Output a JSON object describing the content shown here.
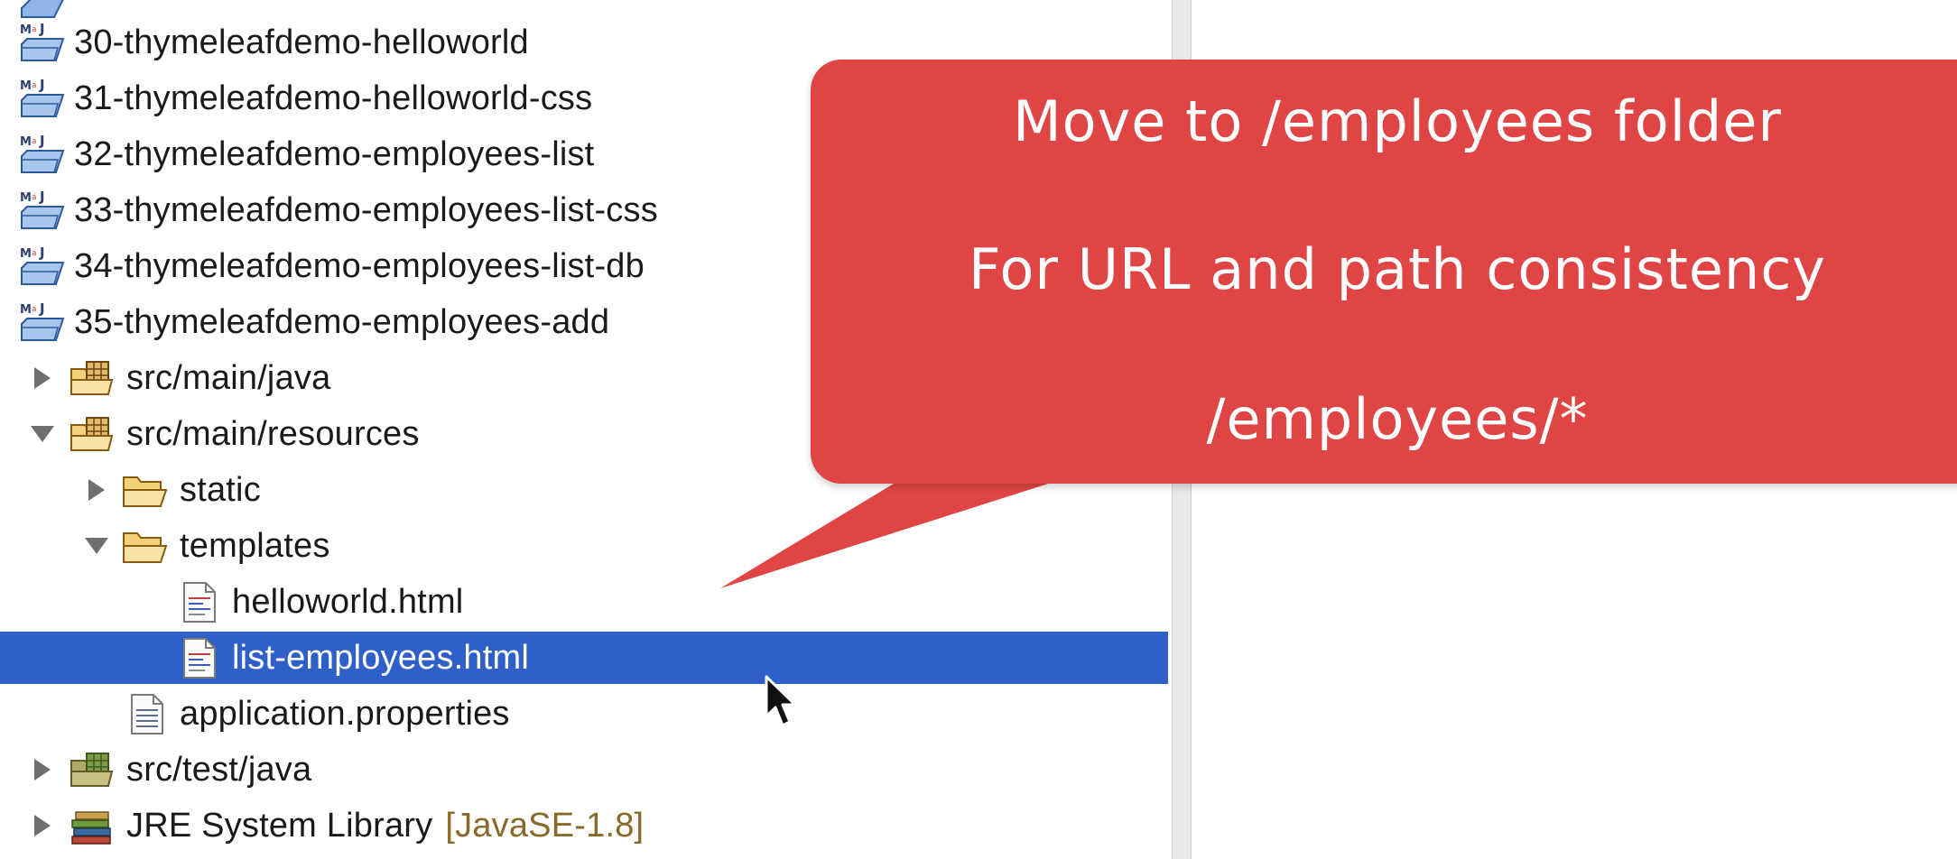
{
  "tree": {
    "projects": [
      {
        "label": "30-thymeleafdemo-helloworld"
      },
      {
        "label": "31-thymeleafdemo-helloworld-css"
      },
      {
        "label": "32-thymeleafdemo-employees-list"
      },
      {
        "label": "33-thymeleafdemo-employees-list-css"
      },
      {
        "label": "34-thymeleafdemo-employees-list-db"
      },
      {
        "label": "35-thymeleafdemo-employees-add"
      }
    ],
    "src_main_java": "src/main/java",
    "src_main_resources": "src/main/resources",
    "static": "static",
    "templates": "templates",
    "helloworld": "helloworld.html",
    "list_employees": "list-employees.html",
    "application_properties": "application.properties",
    "src_test_java": "src/test/java",
    "jre_library": "JRE System Library",
    "jre_version": "[JavaSE-1.8]"
  },
  "callout": {
    "line1": "Move to /employees folder",
    "line2": "For URL and path consistency",
    "line3": "/employees/*"
  },
  "colors": {
    "callout": "#e04545",
    "selection": "#2f5fc8",
    "decoration": "#8a6a2a"
  },
  "icons": {
    "project": "maven-project-icon",
    "package_folder": "source-folder-icon",
    "folder": "folder-open-icon",
    "html_file": "html-file-icon",
    "properties_file": "text-file-icon",
    "library": "library-icon"
  }
}
